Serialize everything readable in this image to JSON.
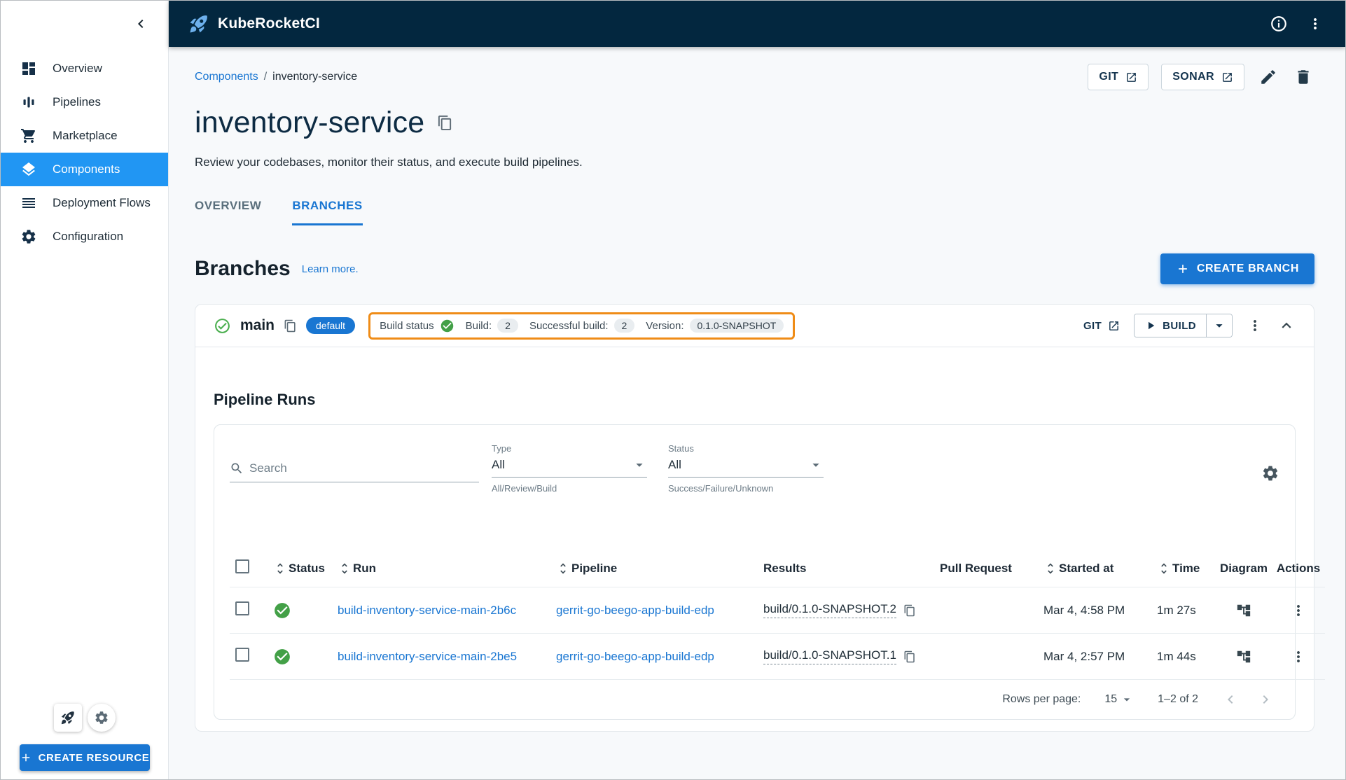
{
  "colors": {
    "primary": "#1976d2",
    "sidebar_active": "#2196f3",
    "navbar_bg": "#03273f",
    "success_green": "#43a047",
    "highlight_orange": "#ef8c17",
    "link": "#1976d2"
  },
  "navbar": {
    "brand": "KubeRocketCI"
  },
  "sidebar": {
    "items": [
      {
        "label": "Overview"
      },
      {
        "label": "Pipelines"
      },
      {
        "label": "Marketplace"
      },
      {
        "label": "Components"
      },
      {
        "label": "Deployment Flows"
      },
      {
        "label": "Configuration"
      }
    ],
    "create_resource_label": "CREATE RESOURCE"
  },
  "header": {
    "breadcrumb": {
      "parent": "Components",
      "separator": "/",
      "current": "inventory-service"
    },
    "git_label": "GIT",
    "sonar_label": "SONAR",
    "title": "inventory-service",
    "subtitle": "Review your codebases, monitor their status, and execute build pipelines."
  },
  "tabs": {
    "overview": "OVERVIEW",
    "branches": "BRANCHES"
  },
  "branches_section": {
    "heading": "Branches",
    "learn_more": "Learn more.",
    "create_branch_label": "CREATE BRANCH"
  },
  "branch": {
    "name": "main",
    "default_chip": "default",
    "build_status_label": "Build status",
    "build_label": "Build:",
    "build_count": "2",
    "successful_build_label": "Successful build:",
    "successful_build_count": "2",
    "version_label": "Version:",
    "version_value": "0.1.0-SNAPSHOT",
    "git_label": "GIT",
    "build_button_label": "BUILD"
  },
  "pipeline_runs": {
    "heading": "Pipeline Runs",
    "search_placeholder": "Search",
    "type_filter": {
      "label": "Type",
      "value": "All",
      "caption": "All/Review/Build"
    },
    "status_filter": {
      "label": "Status",
      "value": "All",
      "caption": "Success/Failure/Unknown"
    },
    "table": {
      "columns": {
        "status": "Status",
        "run": "Run",
        "pipeline": "Pipeline",
        "results": "Results",
        "pull_request": "Pull Request",
        "started_at": "Started at",
        "time": "Time",
        "diagram": "Diagram",
        "actions": "Actions"
      },
      "rows": [
        {
          "run": "build-inventory-service-main-2b6c",
          "pipeline": "gerrit-go-beego-app-build-edp",
          "results": "build/0.1.0-SNAPSHOT.2",
          "started_at": "Mar 4, 4:58 PM",
          "time": "1m 27s"
        },
        {
          "run": "build-inventory-service-main-2be5",
          "pipeline": "gerrit-go-beego-app-build-edp",
          "results": "build/0.1.0-SNAPSHOT.1",
          "started_at": "Mar 4, 2:57 PM",
          "time": "1m 44s"
        }
      ]
    },
    "pagination": {
      "rows_per_page_label": "Rows per page:",
      "rows_per_page_value": "15",
      "range_label": "1–2 of 2"
    }
  }
}
